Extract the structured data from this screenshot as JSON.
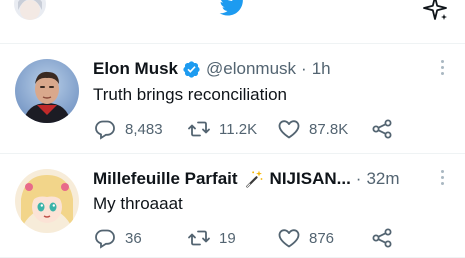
{
  "colors": {
    "brand_blue": "#1d9bf0",
    "text_primary": "#0f1419",
    "text_secondary": "#536471",
    "divider": "#eff3f4"
  },
  "topbar": {
    "logo_icon": "twitter-bird-icon",
    "right_icon": "sparkle-icon"
  },
  "tweets": [
    {
      "name": "Elon Musk",
      "verified": true,
      "handle": "@elonmusk",
      "separator": "·",
      "time": "1h",
      "text": "Truth brings reconciliation",
      "replies": "8,483",
      "retweets": "11.2K",
      "likes": "87.8K"
    },
    {
      "name": "Millefeuille Parfait",
      "name_suffix": "NIJISAN...",
      "separator": "·",
      "time": "32m",
      "text": "My throaaat",
      "replies": "36",
      "retweets": "19",
      "likes": "876"
    }
  ]
}
